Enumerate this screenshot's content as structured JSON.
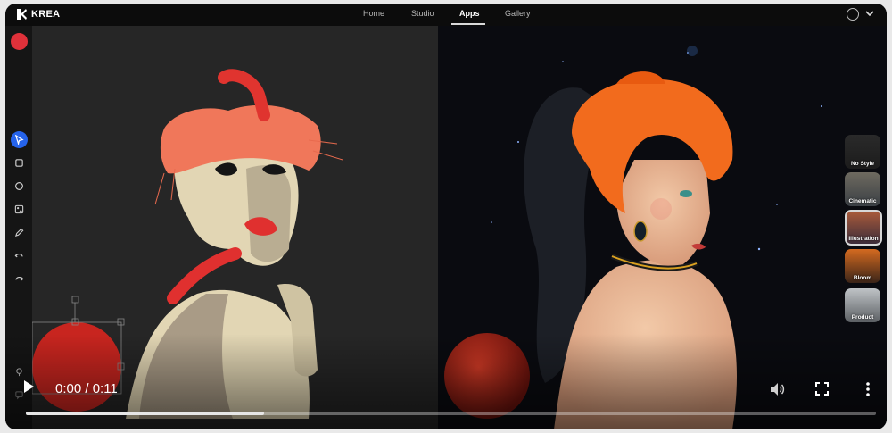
{
  "brand": {
    "name": "KREA",
    "logo_icon": "krea-logo-icon"
  },
  "nav": {
    "items": [
      "Home",
      "Studio",
      "Apps",
      "Gallery"
    ],
    "active": "Apps"
  },
  "header_right": {
    "user_icon": "user-circle-icon",
    "menu_icon": "chevron-down-icon"
  },
  "toolbar": {
    "tools": [
      "pointer-icon",
      "square-icon",
      "circle-icon",
      "image-shapes-icon",
      "pen-icon",
      "undo-icon",
      "redo-icon",
      "microphone-icon",
      "chat-icon"
    ],
    "active_tool": "pointer-icon"
  },
  "styles": {
    "items": [
      "No Style",
      "Cinematic",
      "Illustration",
      "Bloom",
      "Product"
    ],
    "selected": "Illustration"
  },
  "video": {
    "time": "0:00 / 0:11",
    "progress": 0.28
  },
  "colors": {
    "accent": "#2563eb",
    "topbar": "#0c0c0c",
    "canvas": "#262626"
  }
}
